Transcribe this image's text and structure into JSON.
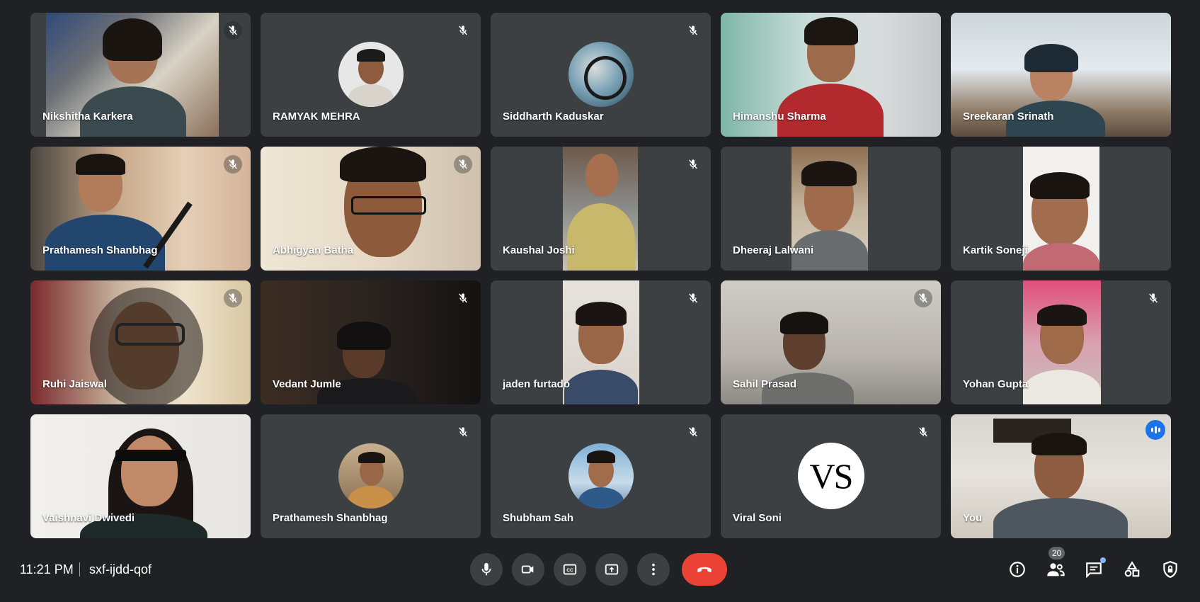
{
  "meeting": {
    "time": "11:21 PM",
    "code": "sxf-ijdd-qof",
    "participant_count": "20"
  },
  "participants": [
    {
      "name": "Nikshitha Karkera",
      "muted": true,
      "mode": "video"
    },
    {
      "name": "RAMYAK MEHRA",
      "muted": true,
      "mode": "avatar"
    },
    {
      "name": "Siddharth Kaduskar",
      "muted": true,
      "mode": "avatar"
    },
    {
      "name": "Himanshu Sharma",
      "muted": false,
      "mode": "video"
    },
    {
      "name": "Sreekaran Srinath",
      "muted": false,
      "mode": "video"
    },
    {
      "name": "Prathamesh Shanbhag",
      "muted": true,
      "mode": "video"
    },
    {
      "name": "Abhigyan Batha",
      "muted": true,
      "mode": "video"
    },
    {
      "name": "Kaushal Joshi",
      "muted": true,
      "mode": "video"
    },
    {
      "name": "Dheeraj Lalwani",
      "muted": false,
      "mode": "video"
    },
    {
      "name": "Kartik Soneji",
      "muted": false,
      "mode": "video"
    },
    {
      "name": "Ruhi Jaiswal",
      "muted": true,
      "mode": "video"
    },
    {
      "name": "Vedant Jumle",
      "muted": true,
      "mode": "video"
    },
    {
      "name": "jaden furtado",
      "muted": true,
      "mode": "video"
    },
    {
      "name": "Sahil Prasad",
      "muted": true,
      "mode": "video"
    },
    {
      "name": "Yohan Gupta",
      "muted": true,
      "mode": "video"
    },
    {
      "name": "Vaishnavi Dwivedi",
      "muted": false,
      "mode": "video"
    },
    {
      "name": "Prathamesh Shanbhag",
      "muted": true,
      "mode": "avatar"
    },
    {
      "name": "Shubham Sah",
      "muted": true,
      "mode": "avatar"
    },
    {
      "name": "Viral Soni",
      "muted": true,
      "mode": "initials",
      "initials": "VS"
    },
    {
      "name": "You",
      "muted": false,
      "mode": "video",
      "speaking": true
    }
  ],
  "controls": {
    "icons": [
      "mic-icon",
      "camera-icon",
      "captions-icon",
      "present-icon",
      "more-options-icon",
      "end-call-icon"
    ]
  },
  "side_icons": [
    "info-icon",
    "people-icon",
    "chat-icon",
    "activities-icon",
    "host-controls-icon"
  ],
  "colors": {
    "background": "#202124",
    "tile": "#3c4043",
    "end_call": "#ea4335",
    "accent": "#8ab4f8",
    "speaking": "#1a73e8"
  }
}
